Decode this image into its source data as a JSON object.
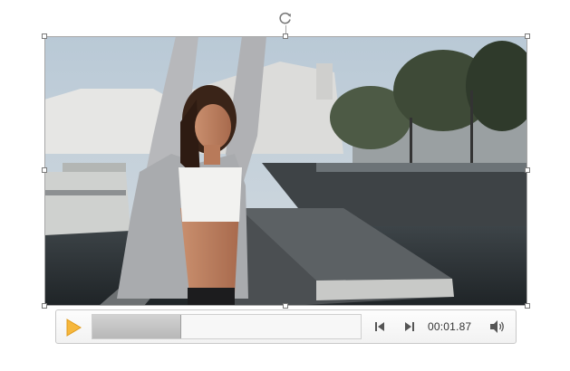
{
  "player": {
    "time": "00:01.87",
    "progress_fraction": 0.33
  },
  "icons": {
    "play": "play-icon",
    "rewind": "step-back-icon",
    "forward": "step-forward-icon",
    "volume": "volume-icon",
    "rotate": "rotate-handle-icon"
  },
  "colors": {
    "play_accent": "#f6b73c",
    "progress_fill": "#c4c4c4",
    "selection_border": "#a6a6a6"
  }
}
